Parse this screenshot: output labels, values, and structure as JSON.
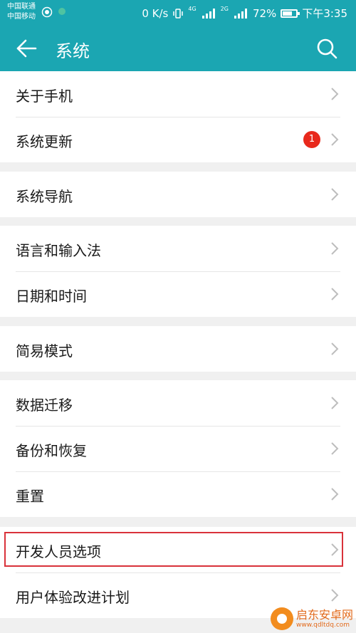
{
  "status_bar": {
    "carrier1": "中国联通",
    "carrier2": "中国移动",
    "speed": "0 K/s",
    "net1": "4G",
    "net2": "2G",
    "battery": "72%",
    "battery_level": 0.72,
    "time": "下午3:35"
  },
  "app_bar": {
    "title": "系统",
    "back_icon": "arrow-left-icon",
    "search_icon": "search-icon"
  },
  "groups": [
    {
      "items": [
        {
          "label": "关于手机"
        },
        {
          "label": "系统更新",
          "badge": "1"
        }
      ]
    },
    {
      "items": [
        {
          "label": "系统导航"
        }
      ]
    },
    {
      "items": [
        {
          "label": "语言和输入法"
        },
        {
          "label": "日期和时间"
        }
      ]
    },
    {
      "items": [
        {
          "label": "简易模式"
        }
      ]
    },
    {
      "items": [
        {
          "label": "数据迁移"
        },
        {
          "label": "备份和恢复"
        },
        {
          "label": "重置"
        }
      ]
    },
    {
      "items": [
        {
          "label": "开发人员选项"
        },
        {
          "label": "用户体验改进计划"
        }
      ]
    }
  ],
  "watermark": {
    "text": "启东安卓网",
    "url": "www.qdltdq.com"
  },
  "colors": {
    "accent": "#1ba6b2",
    "badge": "#e8291c",
    "highlight": "#d9323a"
  }
}
